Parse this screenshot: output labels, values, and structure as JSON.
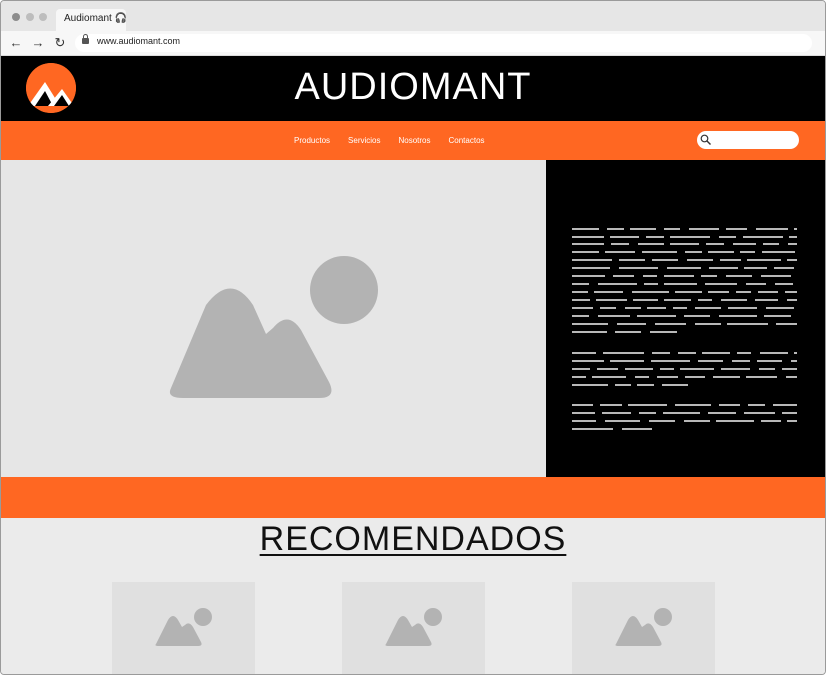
{
  "browser": {
    "tab_title": "Audiomant 🎧",
    "url": "www.audiomant.com",
    "back_icon": "arrow-left-icon",
    "forward_icon": "arrow-right-icon",
    "reload_icon": "reload-icon"
  },
  "site": {
    "title": "AUDIOMANT",
    "logo_icon": "mountain-logo-icon"
  },
  "nav": {
    "items": [
      {
        "label": "Productos"
      },
      {
        "label": "Servicios"
      },
      {
        "label": "Nosotros"
      },
      {
        "label": "Contactos"
      }
    ],
    "search_placeholder": ""
  },
  "hero": {
    "image_icon": "image-placeholder-icon"
  },
  "recommended": {
    "title": "RECOMENDADOS",
    "cards": [
      {
        "image_icon": "image-placeholder-icon"
      },
      {
        "image_icon": "image-placeholder-icon"
      },
      {
        "image_icon": "image-placeholder-icon"
      }
    ]
  },
  "colors": {
    "accent": "#ff6722",
    "header_bg": "#000000",
    "placeholder_bg": "#e6e6e6",
    "placeholder_icon": "#b3b3b3"
  }
}
